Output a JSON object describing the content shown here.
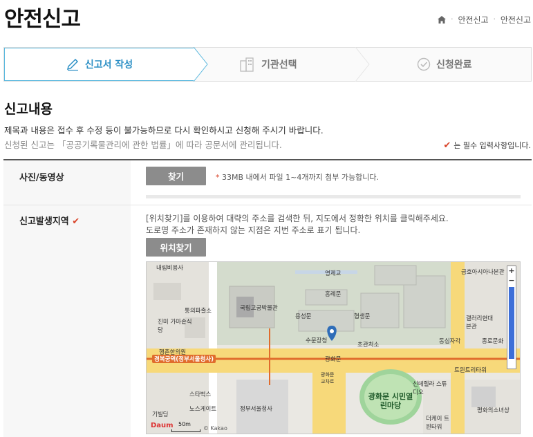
{
  "header": {
    "title": "안전신고",
    "breadcrumb": [
      "안전신고",
      "안전신고"
    ]
  },
  "steps": [
    {
      "label": "신고서 작성",
      "icon": "pencil-icon",
      "active": true
    },
    {
      "label": "기관선택",
      "icon": "building-icon",
      "active": false
    },
    {
      "label": "신청완료",
      "icon": "check-circle-icon",
      "active": false
    }
  ],
  "section": {
    "title": "신고내용",
    "notice1": "제목과 내용은 접수 후 수정 등이 불가능하므로 다시 확인하시고 신청해 주시기 바랍니다.",
    "notice2": "신청된 신고는 「공공기록물관리에 관한 법률」에 따라 공문서에 관리됩니다.",
    "required_note": "는 필수 입력사항입니다."
  },
  "form": {
    "photo": {
      "label": "사진/동영상",
      "button": "찾기",
      "hint_star": "*",
      "hint": "33MB 내에서 파일 1~4개까지 첨부 가능합니다."
    },
    "location": {
      "label": "신고발생지역",
      "desc1": "[위치찾기]를 이용하여 대략의 주소를 검색한 뒤, 지도에서 정확한 위치를 클릭해주세요.",
      "desc2": "도로명 주소가 존재하지 않는 지점은 지번 주소로 표기 됩니다.",
      "button": "위치찾기"
    }
  },
  "map": {
    "labels": [
      {
        "id": "l1",
        "text": "내림비용사"
      },
      {
        "id": "l2",
        "text": "영제교"
      },
      {
        "id": "l3",
        "text": "금호아시아나본관"
      },
      {
        "id": "l4",
        "text": "흥례문"
      },
      {
        "id": "l5",
        "text": "통의파출소"
      },
      {
        "id": "l6",
        "text": "국립고궁박물관"
      },
      {
        "id": "l7",
        "text": "용성문"
      },
      {
        "id": "l8",
        "text": "협생문"
      },
      {
        "id": "l9",
        "text": "갤러리현대 본관"
      },
      {
        "id": "l10",
        "text": "진미 가마솥식당"
      },
      {
        "id": "l11",
        "text": "수문장청"
      },
      {
        "id": "l12",
        "text": "광화문"
      },
      {
        "id": "l13",
        "text": "초관처소"
      },
      {
        "id": "l14",
        "text": "동십자각"
      },
      {
        "id": "l15",
        "text": "종로문화"
      },
      {
        "id": "l16",
        "text": "행촌한의원"
      },
      {
        "id": "l17",
        "text": "경복궁역(정부서울청사)"
      },
      {
        "id": "l18",
        "text": "트윈트리타워"
      },
      {
        "id": "l19",
        "text": "광화문 교차로"
      },
      {
        "id": "l20",
        "text": "스타벅스"
      },
      {
        "id": "l21",
        "text": "신데렐라 스튜디오"
      },
      {
        "id": "l22",
        "text": "광화문 시민열린마당"
      },
      {
        "id": "l23",
        "text": "노스게이트"
      },
      {
        "id": "l24",
        "text": "정부서울청사"
      },
      {
        "id": "l25",
        "text": "더케이 트윈타워"
      },
      {
        "id": "l26",
        "text": "평화의소녀상"
      },
      {
        "id": "l27",
        "text": "기빌딩"
      }
    ],
    "scale": "50m",
    "logo": "Daum",
    "copyright": "© Kakao",
    "zoom_in": "+",
    "zoom_out": "−"
  }
}
